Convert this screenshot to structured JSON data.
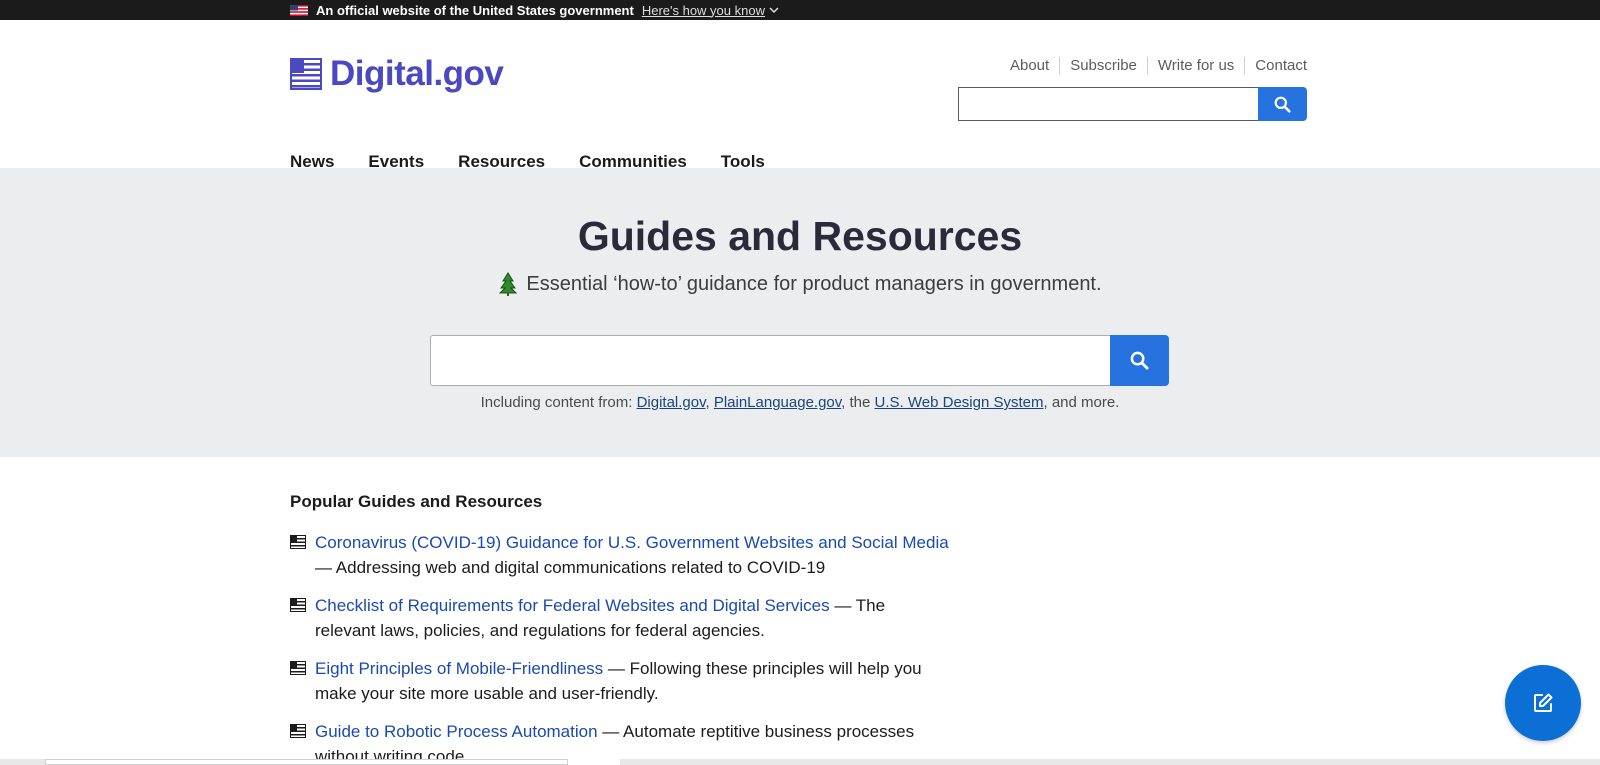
{
  "banner": {
    "official_text": "An official website of the United States government",
    "how_text": "Here's how you know"
  },
  "header": {
    "logo_text": "Digital.gov",
    "util_links": [
      "About",
      "Subscribe",
      "Write for us",
      "Contact"
    ],
    "search_placeholder": "",
    "nav": [
      "News",
      "Events",
      "Resources",
      "Communities",
      "Tools"
    ]
  },
  "hero": {
    "title": "Guides and Resources",
    "subtitle": "Essential ‘how-to’ guidance for product managers in government.",
    "search_placeholder": "",
    "note": {
      "prefix": "Including content from: ",
      "link1": "Digital.gov",
      "sep1": ", ",
      "link2": "PlainLanguage.gov",
      "sep2": ", the ",
      "link3": "U.S. Web Design System",
      "suffix": ", and more."
    }
  },
  "popular": {
    "heading": "Popular Guides and Resources",
    "items": [
      {
        "title": "Coronavirus (COVID-19) Guidance for U.S. Government Websites and Social Media",
        "desc": " — Addressing web and digital communications related to COVID-19"
      },
      {
        "title": "Checklist of Requirements for Federal Websites and Digital Services",
        "desc": " — The relevant laws, policies, and regulations for federal agencies."
      },
      {
        "title": "Eight Principles of Mobile-Friendliness",
        "desc": " — Following these principles will help you make your site more usable and user-friendly."
      },
      {
        "title": "Guide to Robotic Process Automation",
        "desc": " — Automate reptitive business processes without writing code."
      }
    ]
  },
  "colors": {
    "brand": "#4a49c2",
    "accent": "#2672de",
    "link": "#1a4ab0",
    "fab": "#0b6fd6"
  },
  "icons": {
    "banner_flag": "us-flag-icon",
    "banner_chevron": "chevron-down-icon",
    "logo": "flag-logo-icon",
    "search": "search-icon",
    "hero": "tree-icon",
    "bullet": "flag-bullet-icon",
    "fab": "edit-icon"
  }
}
